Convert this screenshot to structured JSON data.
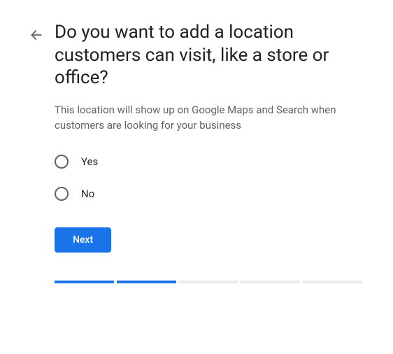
{
  "heading": "Do you want to add a location customers can visit, like a store or office?",
  "subtext": "This location will show up on Google Maps and Search when customers are looking for your business",
  "options": {
    "yes": "Yes",
    "no": "No"
  },
  "next_label": "Next",
  "progress": {
    "total": 5,
    "completed": 2
  }
}
